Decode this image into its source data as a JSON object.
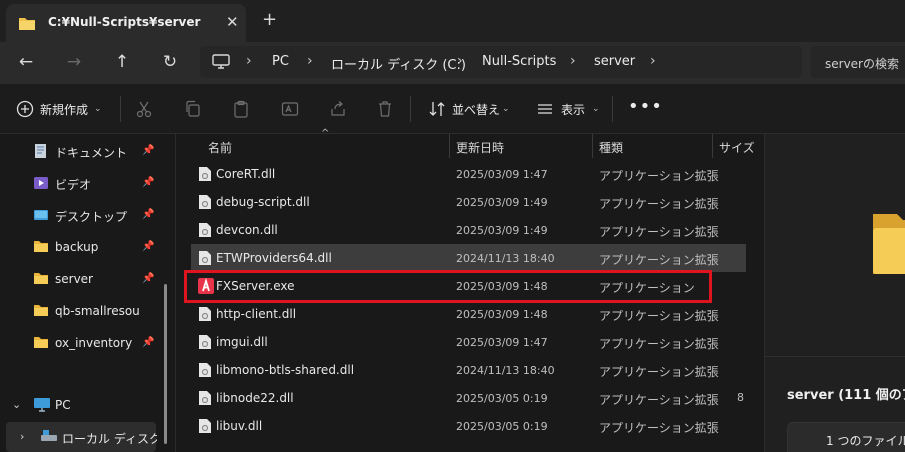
{
  "tab": {
    "title": "C:¥Null-Scripts¥server",
    "close": "✕",
    "new": "+"
  },
  "address": {
    "crumbs": [
      "PC",
      "ローカル ディスク (C:)",
      "Null-Scripts",
      "server"
    ],
    "search_placeholder": "serverの検索"
  },
  "toolbar": {
    "new_label": "新規作成",
    "sort_label": "並べ替え",
    "view_label": "表示",
    "more": "•••"
  },
  "sidebar": {
    "items": [
      {
        "label": "ドキュメント",
        "icon": "document-icon"
      },
      {
        "label": "ビデオ",
        "icon": "video-icon"
      },
      {
        "label": "デスクトップ",
        "icon": "desktop-icon"
      },
      {
        "label": "backup",
        "icon": "folder-icon"
      },
      {
        "label": "server",
        "icon": "folder-icon"
      },
      {
        "label": "qb-smallresources",
        "icon": "folder-icon"
      },
      {
        "label": "ox_inventory",
        "icon": "folder-icon"
      }
    ],
    "pc_label": "PC",
    "drive_label": "ローカル ディスク (C:)"
  },
  "columns": {
    "name": "名前",
    "date": "更新日時",
    "type": "種類",
    "size": "サイズ"
  },
  "files": [
    {
      "name": "CoreRT.dll",
      "date": "2025/03/09 1:47",
      "type": "アプリケーション拡張",
      "size": ""
    },
    {
      "name": "debug-script.dll",
      "date": "2025/03/09 1:49",
      "type": "アプリケーション拡張",
      "size": ""
    },
    {
      "name": "devcon.dll",
      "date": "2025/03/09 1:49",
      "type": "アプリケーション拡張",
      "size": ""
    },
    {
      "name": "ETWProviders64.dll",
      "date": "2024/11/13 18:40",
      "type": "アプリケーション拡張",
      "size": ""
    },
    {
      "name": "FXServer.exe",
      "date": "2025/03/09 1:48",
      "type": "アプリケーション",
      "size": ""
    },
    {
      "name": "http-client.dll",
      "date": "2025/03/09 1:48",
      "type": "アプリケーション拡張",
      "size": ""
    },
    {
      "name": "imgui.dll",
      "date": "2025/03/09 1:47",
      "type": "アプリケーション拡張",
      "size": ""
    },
    {
      "name": "libmono-btls-shared.dll",
      "date": "2024/11/13 18:40",
      "type": "アプリケーション拡張",
      "size": ""
    },
    {
      "name": "libnode22.dll",
      "date": "2025/03/05 0:19",
      "type": "アプリケーション拡張",
      "size": "8"
    },
    {
      "name": "libuv.dll",
      "date": "2025/03/05 0:19",
      "type": "アプリケーション拡張",
      "size": ""
    }
  ],
  "details": {
    "title": "server (111 個のア",
    "selection": "1 つのファイルを"
  },
  "colors": {
    "highlight": "#e0141e",
    "folder": "#f0c24a",
    "accent": "#4ea1f3"
  }
}
